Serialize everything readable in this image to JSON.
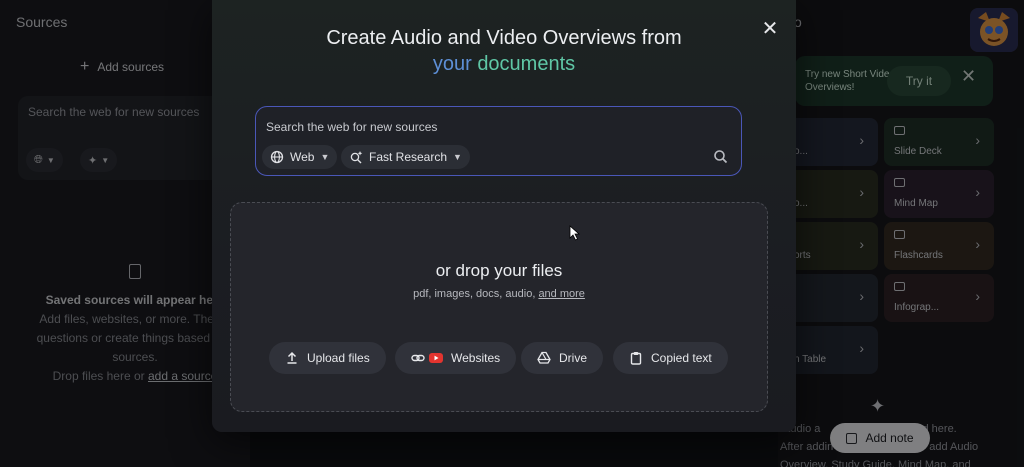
{
  "background": {
    "sources_title": "Sources",
    "add_sources_label": "Add sources",
    "search_placeholder": "Search the web for new sources",
    "empty_heading": "Saved sources will appear here",
    "empty_line1": "Add files, websites, or more. Then a",
    "empty_line2": "questions or create things based on t",
    "empty_line3": "sources.",
    "empty_line4_prefix": "Drop files here or",
    "empty_line4_link": "add a source",
    "studio_title": "o",
    "promo_text": "Try new Short Video Overviews!",
    "promo_try": "Try it",
    "studio_cards": [
      {
        "label": "o...",
        "color": "#262a3a"
      },
      {
        "label": "Slide Deck",
        "color": "#1f3127"
      },
      {
        "label": "o...",
        "color": "#2b2f22"
      },
      {
        "label": "Mind Map",
        "color": "#2d2230"
      },
      {
        "label": "orts",
        "color": "#2a2f22"
      },
      {
        "label": "Flashcards",
        "color": "#332b22"
      },
      {
        "label": "",
        "color": "#262a34"
      },
      {
        "label": "Infograp...",
        "color": "#2e2226"
      },
      {
        "label": "n Table",
        "color": "#242833"
      }
    ],
    "studio_hint1": "Studio a",
    "studio_hint1_end": "ed here.",
    "studio_hint2": "After addin",
    "studio_hint2_end": "add Audio",
    "studio_hint3": "Overview, Study Guide, Mind Map, and",
    "add_note_label": "Add note"
  },
  "modal": {
    "title": "Create Audio and Video Overviews from",
    "subtitle_part1": "your",
    "subtitle_part2": "documents",
    "search_placeholder": "Search the web for new sources",
    "source_chip": "Web",
    "mode_chip": "Fast Research",
    "drop_title": "or drop your files",
    "drop_formats": "pdf, images, docs, audio,",
    "drop_more_link": "and more",
    "buttons": {
      "upload": "Upload files",
      "websites": "Websites",
      "drive": "Drive",
      "copied_text": "Copied text"
    }
  },
  "colors": {
    "accent_blue": "#5d8fd6",
    "accent_teal": "#5fc7a6",
    "search_border": "#4a57b8",
    "youtube_red": "#e3342f"
  }
}
